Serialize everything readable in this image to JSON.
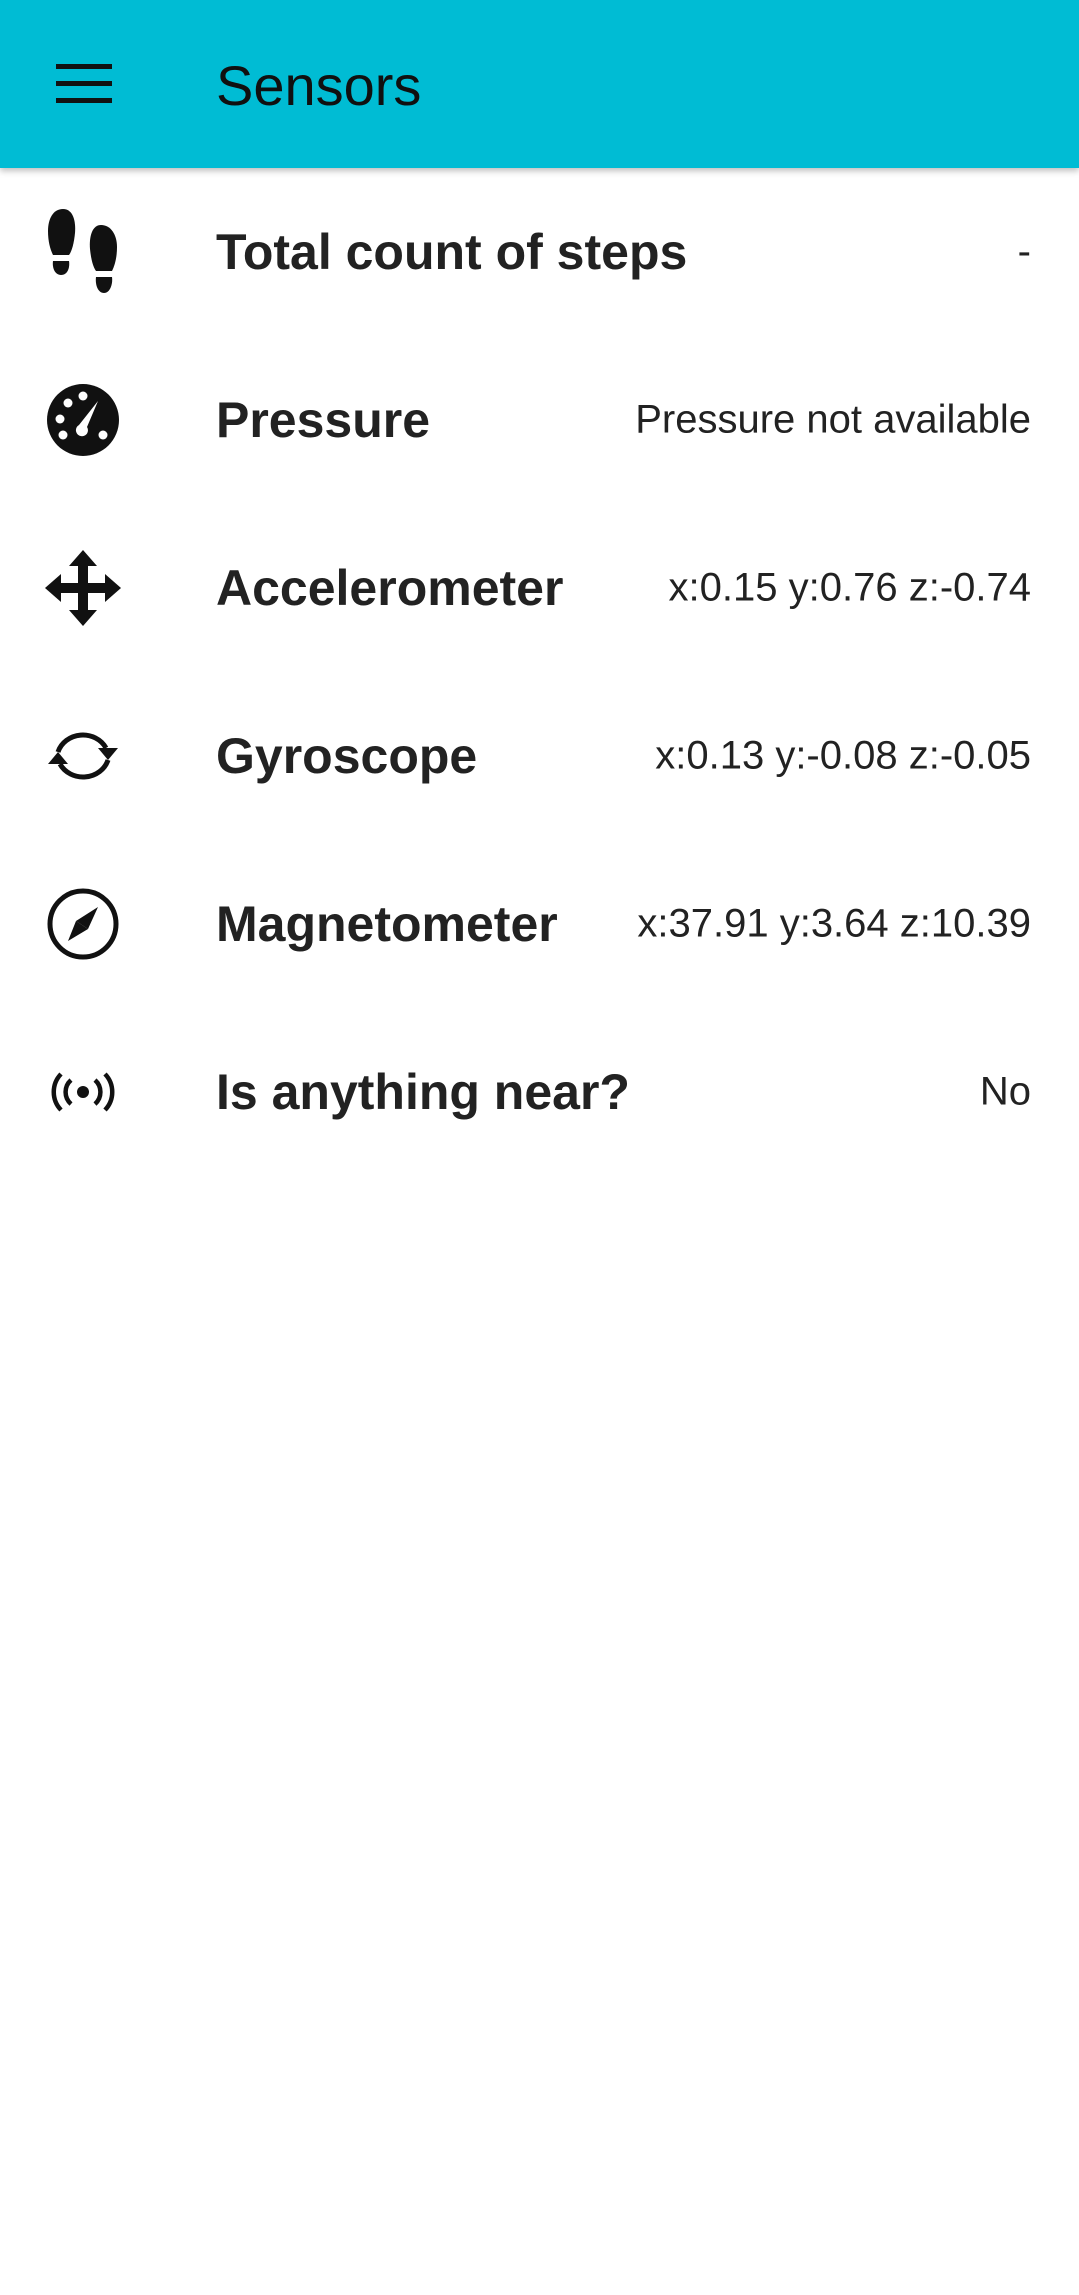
{
  "app_bar": {
    "title": "Sensors",
    "background": "#00BCD4",
    "menu_icon": "hamburger-menu-icon"
  },
  "sensors": [
    {
      "icon": "footsteps-icon",
      "label": "Total count of steps",
      "value": "-"
    },
    {
      "icon": "gauge-icon",
      "label": "Pressure",
      "value": "Pressure not available"
    },
    {
      "icon": "move-arrows-icon",
      "label": "Accelerometer",
      "value": "x:0.15 y:0.76 z:-0.74"
    },
    {
      "icon": "rotate-icon",
      "label": "Gyroscope",
      "value": "x:0.13 y:-0.08 z:-0.05"
    },
    {
      "icon": "compass-icon",
      "label": "Magnetometer",
      "value": "x:37.91 y:3.64 z:10.39"
    },
    {
      "icon": "proximity-signal-icon",
      "label": "Is anything near?",
      "value": "No"
    }
  ]
}
